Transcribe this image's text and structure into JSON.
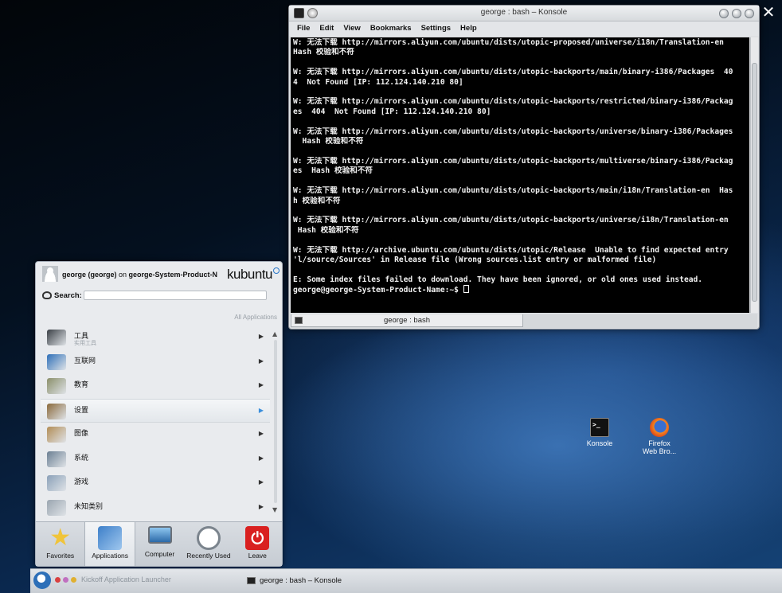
{
  "konsole": {
    "title": "george : bash – Konsole",
    "menu": [
      "File",
      "Edit",
      "View",
      "Bookmarks",
      "Settings",
      "Help"
    ],
    "lines": [
      "W: 无法下载 http://mirrors.aliyun.com/ubuntu/dists/utopic-proposed/universe/i18n/Translation-en",
      "Hash 校验和不符",
      "",
      "W: 无法下载 http://mirrors.aliyun.com/ubuntu/dists/utopic-backports/main/binary-i386/Packages  40",
      "4  Not Found [IP: 112.124.140.210 80]",
      "",
      "W: 无法下载 http://mirrors.aliyun.com/ubuntu/dists/utopic-backports/restricted/binary-i386/Packag",
      "es  404  Not Found [IP: 112.124.140.210 80]",
      "",
      "W: 无法下载 http://mirrors.aliyun.com/ubuntu/dists/utopic-backports/universe/binary-i386/Packages",
      "  Hash 校验和不符",
      "",
      "W: 无法下载 http://mirrors.aliyun.com/ubuntu/dists/utopic-backports/multiverse/binary-i386/Packag",
      "es  Hash 校验和不符",
      "",
      "W: 无法下载 http://mirrors.aliyun.com/ubuntu/dists/utopic-backports/main/i18n/Translation-en  Has",
      "h 校验和不符",
      "",
      "W: 无法下载 http://mirrors.aliyun.com/ubuntu/dists/utopic-backports/universe/i18n/Translation-en",
      " Hash 校验和不符",
      "",
      "W: 无法下载 http://archive.ubuntu.com/ubuntu/dists/utopic/Release  Unable to find expected entry",
      "'l/source/Sources' in Release file (Wrong sources.list entry or malformed file)",
      "",
      "E: Some index files failed to download. They have been ignored, or old ones used instead.",
      "george@george-System-Product-Name:~$ "
    ],
    "tab_label": "george : bash"
  },
  "desktop": {
    "konsole_label": "Konsole",
    "firefox_label_1": "Firefox",
    "firefox_label_2": "Web Bro..."
  },
  "kickoff": {
    "user_bold": "george (george)",
    "user_on": " on ",
    "host_bold": "george-System-Product-N",
    "brand": "kubuntu",
    "search_label": "Search:",
    "search_value": "",
    "list_header": "All Applications",
    "items": [
      {
        "label": "工具",
        "sub": "实用工具",
        "icon": "utilities-icon",
        "color": "#3a3f45"
      },
      {
        "label": "互联网",
        "sub": "",
        "icon": "internet-globe-icon",
        "color": "#2e6fb8"
      },
      {
        "label": "教育",
        "sub": "",
        "icon": "education-icon",
        "color": "#8a8f6a"
      },
      {
        "label": "设置",
        "sub": "",
        "icon": "settings-tools-icon",
        "color": "#8b6a3c"
      },
      {
        "label": "图像",
        "sub": "",
        "icon": "graphics-palette-icon",
        "color": "#b28c55"
      },
      {
        "label": "系统",
        "sub": "",
        "icon": "system-icon",
        "color": "#6b7f93"
      },
      {
        "label": "游戏",
        "sub": "",
        "icon": "games-icon",
        "color": "#8aa0b8"
      },
      {
        "label": "未知类别",
        "sub": "",
        "icon": "unknown-category-icon",
        "color": "#9aa5b0"
      }
    ],
    "tabs": [
      {
        "label": "Favorites",
        "icon": "star-icon"
      },
      {
        "label": "Applications",
        "icon": "applications-icon"
      },
      {
        "label": "Computer",
        "icon": "computer-icon"
      },
      {
        "label": "Recently Used",
        "icon": "recent-clock-icon"
      },
      {
        "label": "Leave",
        "icon": "leave-power-icon"
      }
    ]
  },
  "taskbar": {
    "faded_text": "Kickoff Application Launcher",
    "task_label": "george : bash – Konsole",
    "pager_colors": [
      "#d94040",
      "#c070c0",
      "#e0b030"
    ]
  }
}
